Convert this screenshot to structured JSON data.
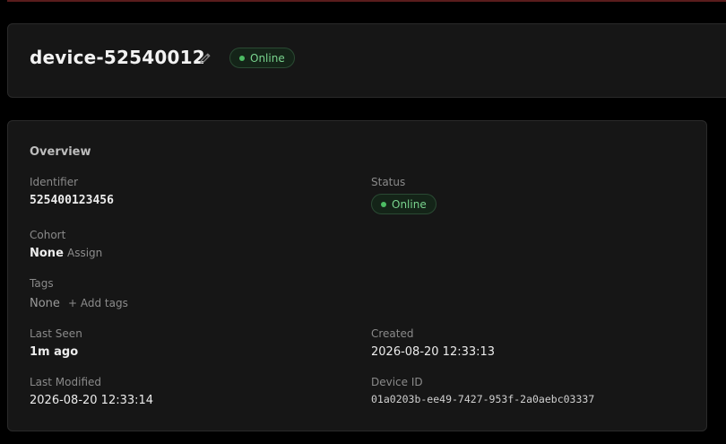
{
  "header": {
    "device_name": "device-52540012",
    "status_label": "Online"
  },
  "overview": {
    "title": "Overview",
    "identifier": {
      "label": "Identifier",
      "value": "525400123456"
    },
    "status": {
      "label": "Status",
      "value": "Online"
    },
    "cohort": {
      "label": "Cohort",
      "value": "None",
      "action": "Assign"
    },
    "tags": {
      "label": "Tags",
      "value": "None",
      "action": "+ Add tags"
    },
    "last_seen": {
      "label": "Last Seen",
      "value": "1m ago"
    },
    "created": {
      "label": "Created",
      "value": "2026-08-20 12:33:13"
    },
    "last_modified": {
      "label": "Last Modified",
      "value": "2026-08-20 12:33:14"
    },
    "device_id": {
      "label": "Device ID",
      "value": "01a0203b-ee49-7427-953f-2a0aebc03337"
    }
  },
  "colors": {
    "status_green": "#79d48e",
    "status_dot": "#4cbd63",
    "card_bg": "#161616",
    "page_bg": "#000000"
  }
}
